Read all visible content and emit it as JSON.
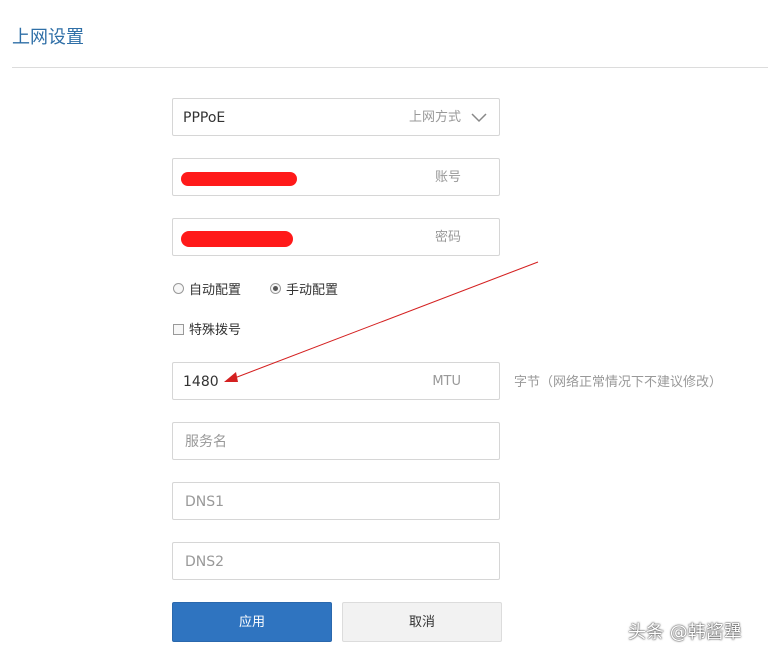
{
  "page": {
    "title": "上网设置"
  },
  "connection": {
    "value": "PPPoE",
    "suffix": "上网方式"
  },
  "account": {
    "suffix": "账号"
  },
  "password": {
    "suffix": "密码"
  },
  "config_mode": {
    "auto_label": "自动配置",
    "manual_label": "手动配置",
    "selected": "manual"
  },
  "special_dial": {
    "label": "特殊拨号",
    "checked": false
  },
  "mtu": {
    "value": "1480",
    "suffix": "MTU",
    "hint": "字节（网络正常情况下不建议修改）"
  },
  "service_name": {
    "placeholder": "服务名"
  },
  "dns1": {
    "placeholder": "DNS1"
  },
  "dns2": {
    "placeholder": "DNS2"
  },
  "buttons": {
    "apply": "应用",
    "cancel": "取消"
  },
  "watermark": {
    "text": "头条 @韩酱犟"
  },
  "colors": {
    "accent": "#2f74c0",
    "title": "#2f6fa7",
    "annotation": "#d42020",
    "redaction": "#ff1a1a"
  }
}
